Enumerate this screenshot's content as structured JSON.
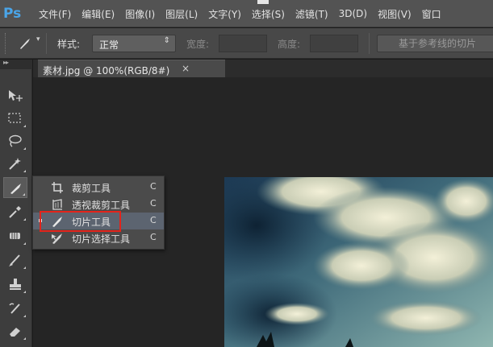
{
  "app": {
    "logo": "Ps"
  },
  "menu": [
    {
      "label": "文件(F)"
    },
    {
      "label": "编辑(E)"
    },
    {
      "label": "图像(I)"
    },
    {
      "label": "图层(L)"
    },
    {
      "label": "文字(Y)"
    },
    {
      "label": "选择(S)"
    },
    {
      "label": "滤镜(T)"
    },
    {
      "label": "3D(D)"
    },
    {
      "label": "视图(V)"
    },
    {
      "label": "窗口"
    }
  ],
  "options": {
    "style_label": "样式:",
    "style_value": "正常",
    "width_label": "宽度:",
    "height_label": "高度:",
    "guides_button": "基于参考线的切片"
  },
  "document": {
    "tab_title": "素材.jpg @ 100%(RGB/8#)",
    "close_glyph": "×"
  },
  "tools": [
    {
      "icon": "move-icon"
    },
    {
      "icon": "marquee-icon"
    },
    {
      "icon": "lasso-icon"
    },
    {
      "icon": "magic-wand-icon"
    },
    {
      "icon": "slice-tool-icon"
    },
    {
      "icon": "eyedropper-icon"
    },
    {
      "icon": "healing-brush-icon"
    },
    {
      "icon": "brush-icon"
    },
    {
      "icon": "clone-stamp-icon"
    },
    {
      "icon": "history-brush-icon"
    },
    {
      "icon": "eraser-icon"
    }
  ],
  "flyout": {
    "items": [
      {
        "label": "裁剪工具",
        "shortcut": "C",
        "icon": "crop-icon"
      },
      {
        "label": "透视裁剪工具",
        "shortcut": "C",
        "icon": "perspective-crop-icon"
      },
      {
        "label": "切片工具",
        "shortcut": "C",
        "icon": "slice-icon",
        "selected": true
      },
      {
        "label": "切片选择工具",
        "shortcut": "C",
        "icon": "slice-select-icon"
      }
    ]
  },
  "colors": {
    "highlight_box": "#e3241b",
    "ps_logo": "#4aa5e8",
    "selected_item": "#5c6470"
  }
}
